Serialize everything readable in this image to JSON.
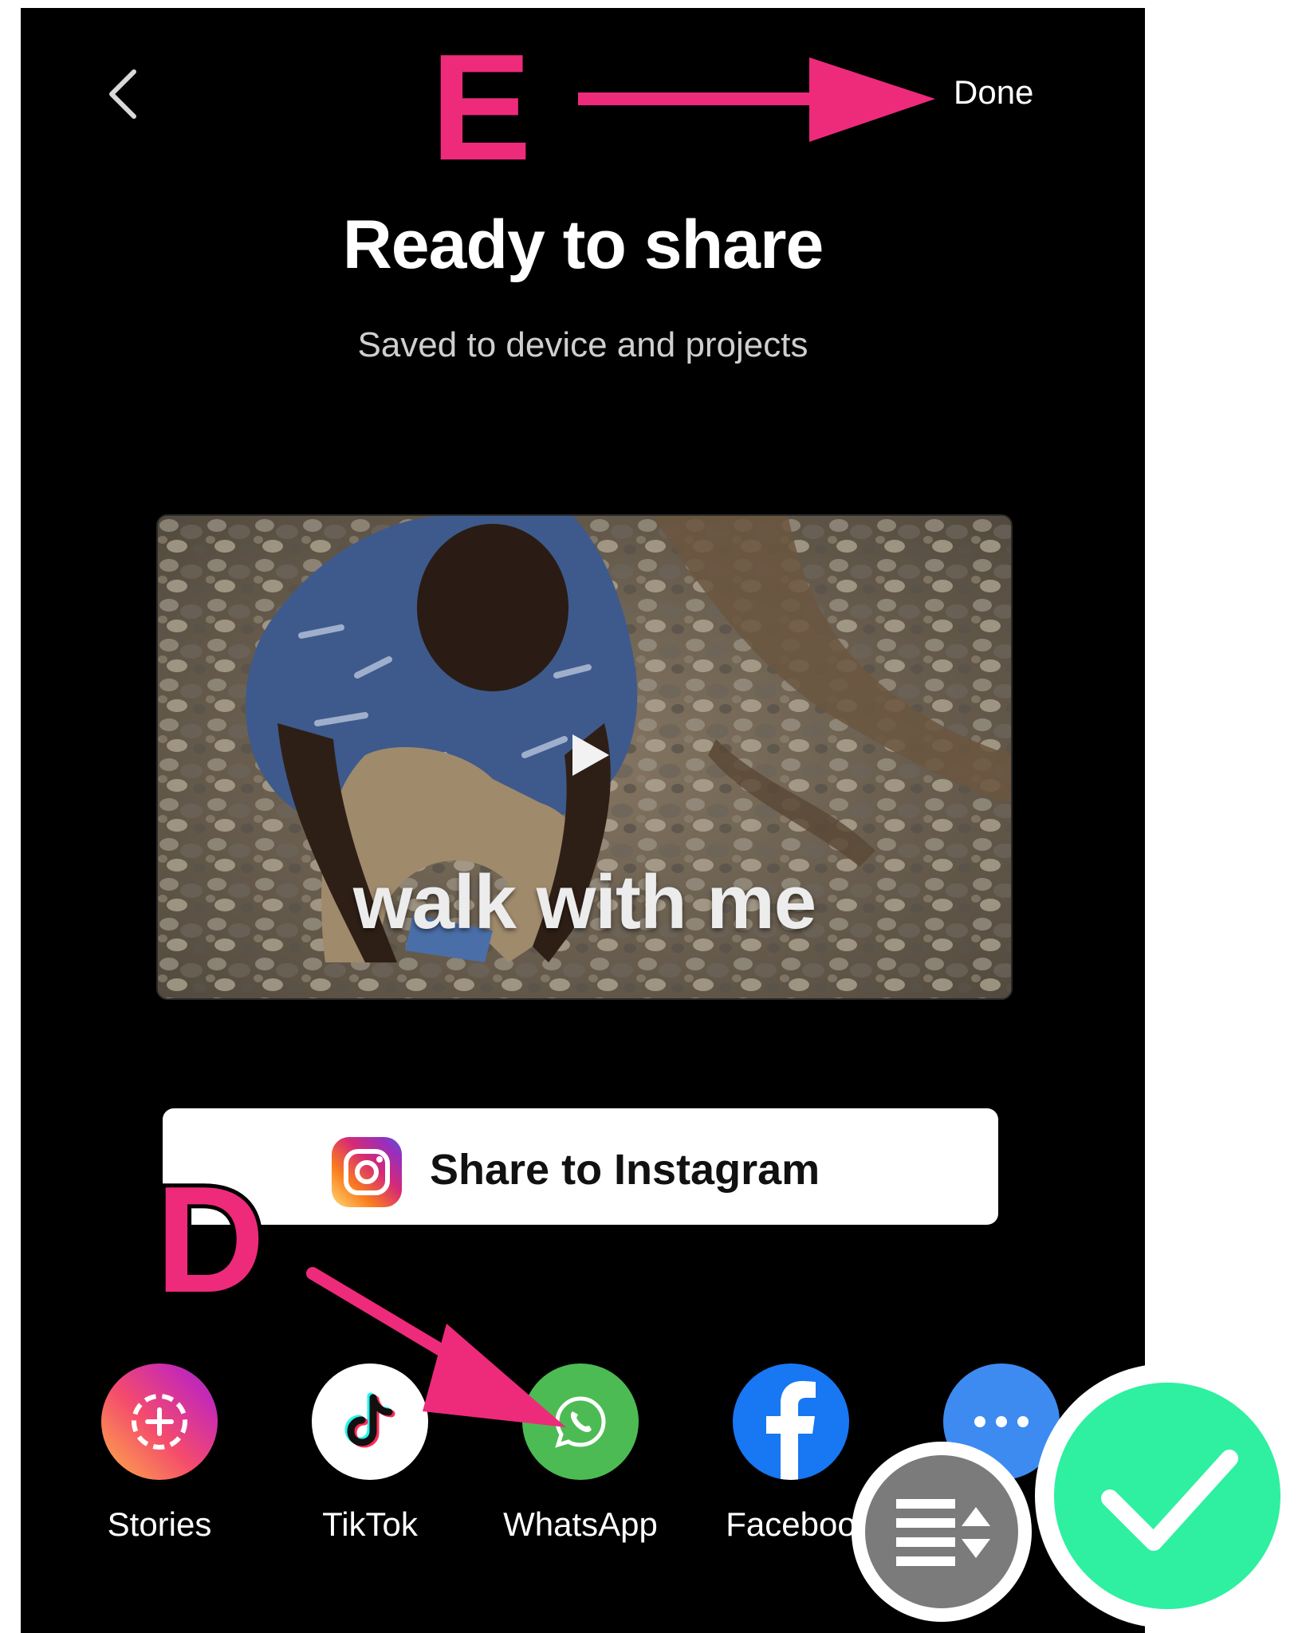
{
  "header": {
    "back_label": "Back",
    "done_label": "Done"
  },
  "main": {
    "title": "Ready to share",
    "subtitle": "Saved to device and projects",
    "video_caption": "walk with me",
    "instagram_button_label": "Share to Instagram"
  },
  "share_targets": [
    {
      "label": "Stories",
      "icon": "stories-icon"
    },
    {
      "label": "TikTok",
      "icon": "tiktok-icon"
    },
    {
      "label": "WhatsApp",
      "icon": "whatsapp-icon"
    },
    {
      "label": "Faceboo",
      "icon": "facebook-icon"
    },
    {
      "label": "",
      "icon": "more-icon"
    }
  ],
  "annotations": {
    "letter_e": "E",
    "letter_d": "D",
    "arrow_color": "#ee2a7b"
  },
  "overlays": {
    "reorder_icon": "reorder-list-icon",
    "confirm_icon": "checkmark-icon",
    "confirm_color": "#2ef0a0"
  }
}
